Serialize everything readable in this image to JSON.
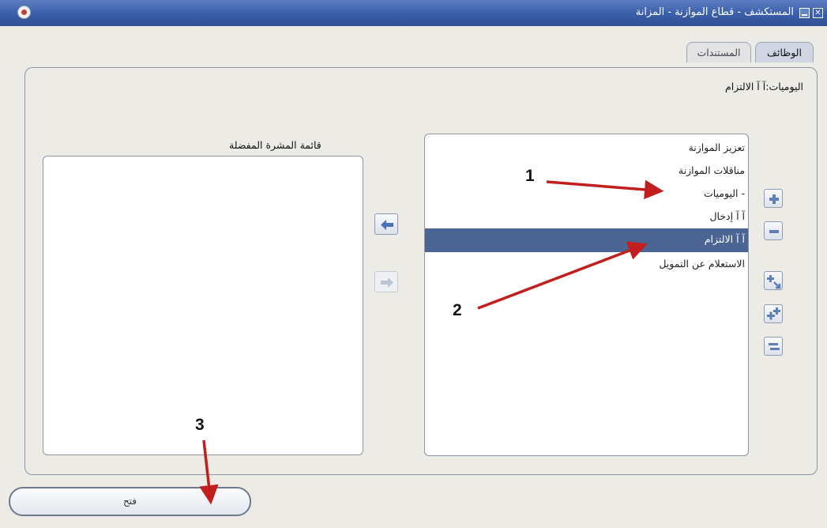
{
  "window": {
    "title": "المستكشف - قطاع الموازنة - المزانة",
    "minimize_icon": "minimize-icon",
    "close_icon": "close-icon",
    "logo_icon": "app-logo-icon"
  },
  "tabs": [
    {
      "label": "الوظائف",
      "active": true
    },
    {
      "label": "المستندات",
      "active": false
    }
  ],
  "breadcrumb": "اليوميات:آ آ   الالتزام",
  "navigator": {
    "items": [
      {
        "label": "تعزيز الموازنة",
        "selected": false
      },
      {
        "label": "مناقلات الموازنة",
        "selected": false
      },
      {
        "label": "- اليوميات",
        "selected": false
      },
      {
        "label": "آ آ   إدخال",
        "selected": false
      },
      {
        "label": "آ آ   الالتزام",
        "selected": true
      },
      {
        "label": "الاستعلام عن التمويل",
        "selected": false
      }
    ],
    "buttons": [
      "expand-icon",
      "collapse-icon",
      "expand-all-icon",
      "expand-branch-icon",
      "collapse-all-icon"
    ]
  },
  "favorites": {
    "label": "قائمة المشرة المفضلة"
  },
  "transfer": {
    "add_icon": "arrow-left-icon",
    "remove_icon": "arrow-right-icon"
  },
  "open_button": {
    "label": "فتح"
  },
  "annotations": [
    "1",
    "2",
    "3"
  ],
  "colors": {
    "title_bar": "#3a5ea9",
    "selection": "#4a6594",
    "annotation_arrow": "#c21e1e"
  }
}
